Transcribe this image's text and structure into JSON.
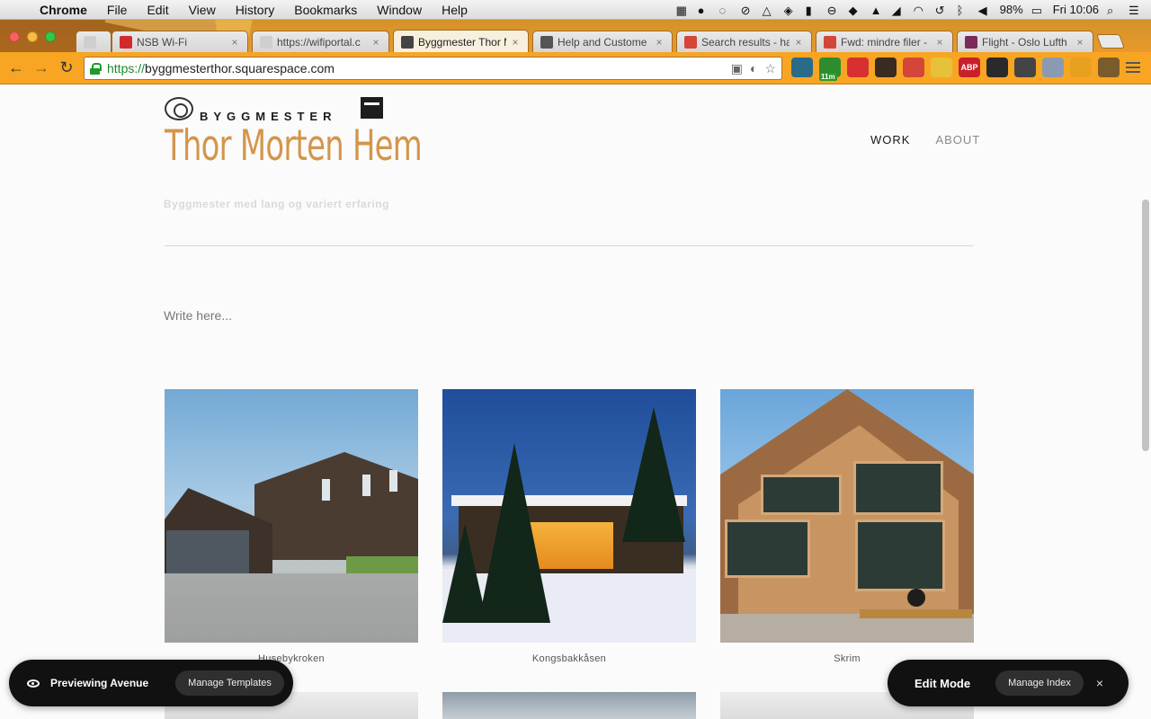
{
  "menubar": {
    "app_name": "Chrome",
    "items": [
      "File",
      "Edit",
      "View",
      "History",
      "Bookmarks",
      "Window",
      "Help"
    ],
    "battery": "98%",
    "clock": "Fri 10:06"
  },
  "tabs": [
    {
      "title": "",
      "favicon_color": "#cfcfcf",
      "active": false
    },
    {
      "title": "NSB Wi-Fi",
      "favicon_color": "#d22a2a",
      "active": false
    },
    {
      "title": "https://wifiportal.c",
      "favicon_color": "#cfcfcf",
      "active": false
    },
    {
      "title": "Byggmester Thor M",
      "favicon_color": "#444444",
      "active": true
    },
    {
      "title": "Help and Custome",
      "favicon_color": "#555555",
      "active": false
    },
    {
      "title": "Search results - ha",
      "favicon_color": "#d44638",
      "active": false
    },
    {
      "title": "Fwd: mindre filer -",
      "favicon_color": "#d44638",
      "active": false
    },
    {
      "title": "Flight - Oslo Lufth",
      "favicon_color": "#7b2a5a",
      "active": false
    }
  ],
  "toolbar": {
    "url_scheme": "https://",
    "url_host": "byggmesterthor.squarespace.com",
    "extensions": [
      {
        "name": "onepassword-icon",
        "color": "#2a6b8a",
        "label": ""
      },
      {
        "name": "timer-extension-icon",
        "color": "#2e8b2e",
        "label": "",
        "badge": "11m"
      },
      {
        "name": "burst-icon",
        "color": "#d83030",
        "label": ""
      },
      {
        "name": "fox-icon",
        "color": "#3a2a20",
        "label": ""
      },
      {
        "name": "gmail-icon",
        "color": "#d44638",
        "label": ""
      },
      {
        "name": "sun-icon",
        "color": "#e6c23a",
        "label": ""
      },
      {
        "name": "adblock-plus-icon",
        "color": "#c8202a",
        "label": "ABP"
      },
      {
        "name": "green-dot-icon",
        "color": "#2a2a2a",
        "label": ""
      },
      {
        "name": "evernote-icon",
        "color": "#444444",
        "label": ""
      },
      {
        "name": "ghost-icon",
        "color": "#8a9ab0",
        "label": ""
      },
      {
        "name": "feed-icon",
        "color": "#e8a020",
        "label": ""
      },
      {
        "name": "pocket-icon",
        "color": "#7a5b2a",
        "label": ""
      }
    ]
  },
  "site": {
    "logo_top": "BYGGMESTER",
    "logo_name": "Thor Morten Hem",
    "nav": [
      "WORK",
      "ABOUT"
    ],
    "tagline": "Byggmester med lang og variert erfaring",
    "write_here": "Write here...",
    "projects": [
      "Husebykroken",
      "Kongsbakkåsen",
      "Skrim"
    ]
  },
  "preview_bar": {
    "label": "Previewing Avenue",
    "button": "Manage Templates"
  },
  "edit_bar": {
    "label": "Edit Mode",
    "button": "Manage Index",
    "close": "×"
  }
}
